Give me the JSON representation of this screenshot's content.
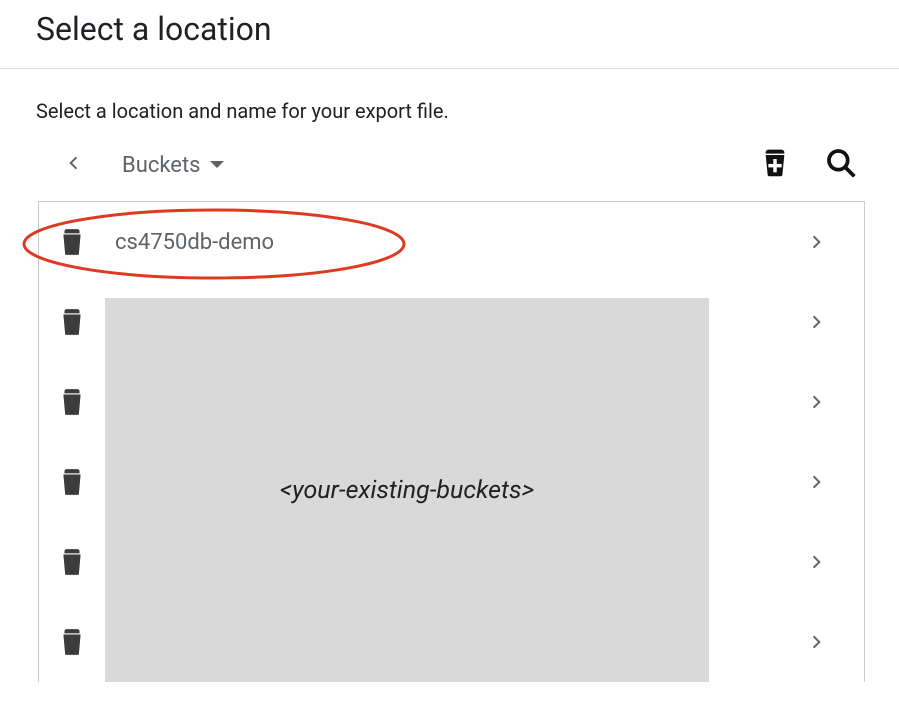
{
  "header": {
    "title": "Select a location"
  },
  "instruction": "Select a location and name for your export file.",
  "breadcrumb": {
    "label": "Buckets"
  },
  "rows": {
    "first": {
      "label": "cs4750db-demo"
    }
  },
  "mask": {
    "text": "<your-existing-buckets>"
  }
}
